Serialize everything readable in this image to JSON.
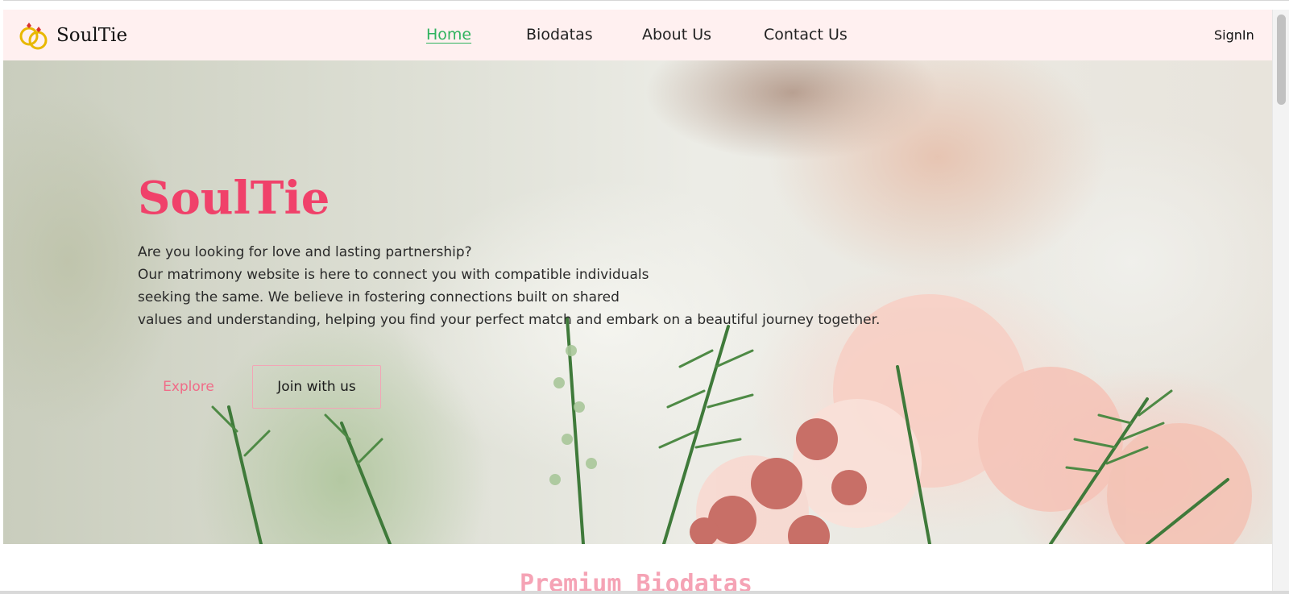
{
  "brand": {
    "name": "SoulTie",
    "logo_icon": "rings-icon",
    "accent_color": "#f0416a"
  },
  "nav": {
    "links": [
      {
        "label": "Home",
        "active": true
      },
      {
        "label": "Biodatas",
        "active": false
      },
      {
        "label": "About Us",
        "active": false
      },
      {
        "label": "Contact Us",
        "active": false
      }
    ],
    "signin_label": "SignIn",
    "active_color": "#2fb35e"
  },
  "hero": {
    "title": "SoulTie",
    "lines": [
      "Are you looking for love and lasting partnership?",
      "Our matrimony website is here to connect you with compatible individuals",
      "seeking the same. We believe in fostering connections built on shared",
      "values and understanding, helping you find your perfect match and embark on a beautiful journey together."
    ],
    "explore_label": "Explore",
    "join_label": "Join with us",
    "background": "wedding-bouquet-photo"
  },
  "premium": {
    "title": "Premium Biodatas"
  }
}
